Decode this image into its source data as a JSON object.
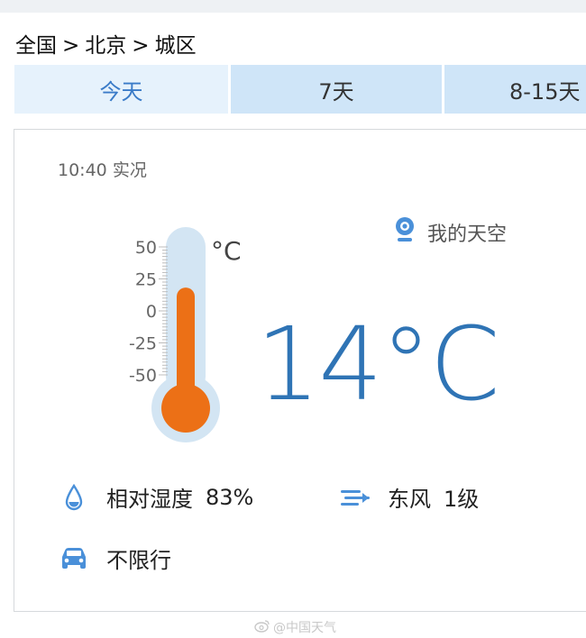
{
  "breadcrumb": {
    "items": [
      "全国",
      "北京",
      "城区"
    ],
    "separator": ">"
  },
  "tabs": [
    {
      "label": "今天",
      "active": true
    },
    {
      "label": "7天",
      "active": false
    },
    {
      "label": "8-15天",
      "active": false
    }
  ],
  "observation": {
    "time": "10:40",
    "label": "实况",
    "temperature": "14°C",
    "my_sky": "我的天空",
    "thermometer": {
      "unit": "°C",
      "ticks": [
        "50",
        "25",
        "0",
        "-25",
        "-50"
      ],
      "value": 14,
      "range": [
        -50,
        50
      ]
    }
  },
  "stats": {
    "humidity_label": "相对湿度",
    "humidity_value": "83%",
    "wind_dir": "东风",
    "wind_level": "1级",
    "traffic": "不限行"
  },
  "icons": {
    "humidity": "water-drop-icon",
    "wind": "wind-icon",
    "traffic": "car-icon",
    "location": "location-pin-icon"
  },
  "colors": {
    "accent": "#2f74b5",
    "tab_active_bg": "#e6f2fc",
    "tab_bg": "#cfe5f8",
    "mercury": "#ec7016",
    "thermo_tube": "#d3e5f3",
    "icon_blue": "#4a90d9"
  },
  "watermark": "@中国天气"
}
